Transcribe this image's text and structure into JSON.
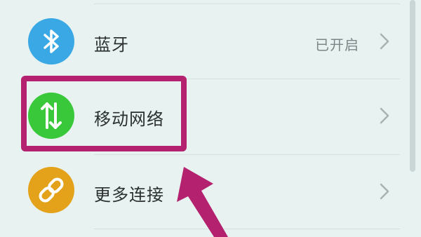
{
  "settings": {
    "items": [
      {
        "label": "蓝牙",
        "value": "已开启",
        "icon": "bluetooth-icon",
        "color": "#3aa8e4"
      },
      {
        "label": "移动网络",
        "value": "",
        "icon": "mobile-data-icon",
        "color": "#39c83a"
      },
      {
        "label": "更多连接",
        "value": "",
        "icon": "link-icon",
        "color": "#e4a21a"
      }
    ]
  },
  "annotation": {
    "highlight_color": "#b4226f"
  }
}
